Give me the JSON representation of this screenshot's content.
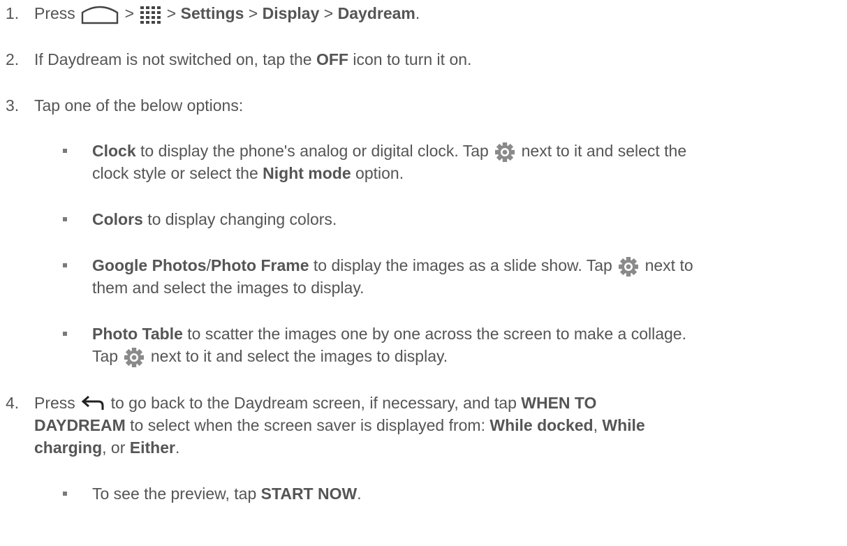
{
  "steps": [
    {
      "number": "1.",
      "segments": [
        {
          "t": "Press ",
          "b": false
        },
        {
          "icon": "home-icon"
        },
        {
          "t": " > ",
          "b": false
        },
        {
          "icon": "apps-grid-icon"
        },
        {
          "t": " > ",
          "b": false
        },
        {
          "t": "Settings",
          "b": true
        },
        {
          "t": " > ",
          "b": false
        },
        {
          "t": "Display",
          "b": true
        },
        {
          "t": " > ",
          "b": false
        },
        {
          "t": "Daydream",
          "b": true
        },
        {
          "t": ".",
          "b": false
        }
      ]
    },
    {
      "number": "2.",
      "segments": [
        {
          "t": "If Daydream is not switched on, tap the ",
          "b": false
        },
        {
          "t": "OFF",
          "b": true
        },
        {
          "t": " icon to turn it on.",
          "b": false
        }
      ]
    },
    {
      "number": "3.",
      "segments": [
        {
          "t": "Tap one of the below options:",
          "b": false
        }
      ]
    },
    {
      "number": "4.",
      "line1": [
        {
          "t": "Press ",
          "b": false
        },
        {
          "icon": "back-arrow-icon"
        },
        {
          "t": " to go back to the Daydream screen, if necessary, and tap ",
          "b": false
        },
        {
          "t": "WHEN TO",
          "b": true
        }
      ],
      "line2": [
        {
          "t": "DAYDREAM",
          "b": true
        },
        {
          "t": " to select when the screen saver is displayed from: ",
          "b": false
        },
        {
          "t": "While docked",
          "b": true
        },
        {
          "t": ", ",
          "b": false
        },
        {
          "t": "While",
          "b": true
        }
      ],
      "line3": [
        {
          "t": "charging",
          "b": true
        },
        {
          "t": ", or ",
          "b": false
        },
        {
          "t": "Either",
          "b": true
        },
        {
          "t": ".",
          "b": false
        }
      ]
    }
  ],
  "options": [
    {
      "line1": [
        {
          "t": "Clock",
          "b": true
        },
        {
          "t": " to display the phone's analog or digital clock. Tap ",
          "b": false
        },
        {
          "icon": "gear-icon"
        },
        {
          "t": " next to it and select the",
          "b": false
        }
      ],
      "line2": [
        {
          "t": "clock style or select the ",
          "b": false
        },
        {
          "t": "Night mode",
          "b": true
        },
        {
          "t": " option.",
          "b": false
        }
      ]
    },
    {
      "line1": [
        {
          "t": "Colors",
          "b": true
        },
        {
          "t": " to display changing colors.",
          "b": false
        }
      ]
    },
    {
      "line1": [
        {
          "t": "Google Photos",
          "b": true
        },
        {
          "t": "/",
          "b": false
        },
        {
          "t": "Photo Frame",
          "b": true
        },
        {
          "t": " to display the images as a slide show. Tap ",
          "b": false
        },
        {
          "icon": "gear-icon"
        },
        {
          "t": " next to",
          "b": false
        }
      ],
      "line2": [
        {
          "t": "them and select the images to display.",
          "b": false
        }
      ]
    },
    {
      "line1": [
        {
          "t": "Photo Table",
          "b": true
        },
        {
          "t": " to scatter the images one by one across the screen to make a collage.",
          "b": false
        }
      ],
      "line2": [
        {
          "t": "Tap ",
          "b": false
        },
        {
          "icon": "gear-icon"
        },
        {
          "t": " next to it and select the images to display.",
          "b": false
        }
      ]
    }
  ],
  "sub_bullet": [
    {
      "t": "To see the preview, tap ",
      "b": false
    },
    {
      "t": "START NOW",
      "b": true
    },
    {
      "t": ".",
      "b": false
    }
  ],
  "colors": {
    "text": "#555555",
    "icon": "#8a8a8a"
  }
}
